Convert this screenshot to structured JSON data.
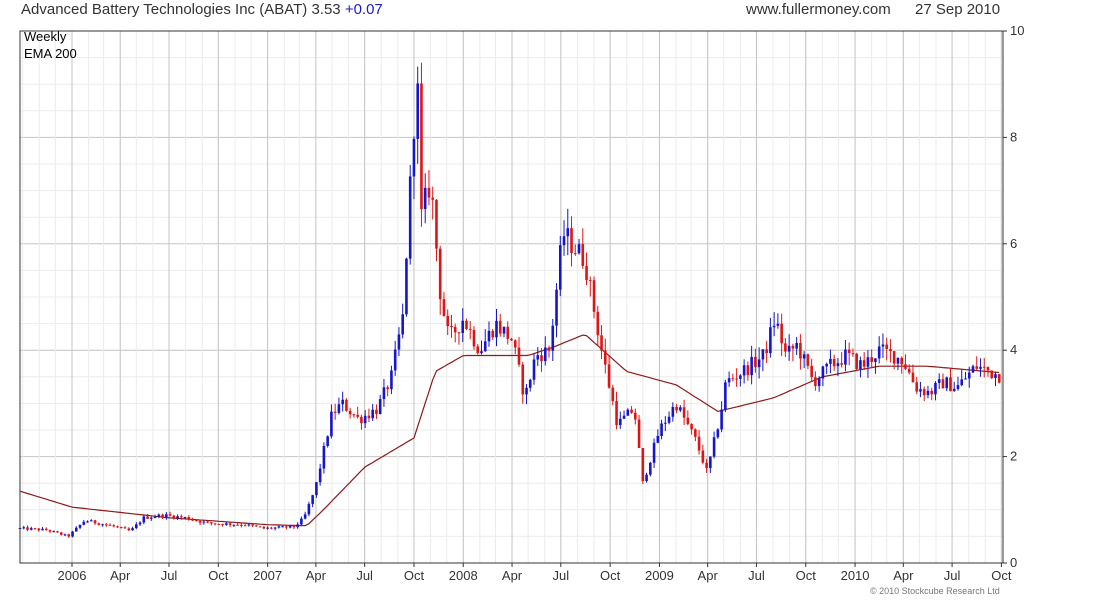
{
  "header": {
    "title": "Advanced Battery Technologies Inc (ABAT)",
    "price": "3.53",
    "change": "+0.07",
    "site": "www.fullermoney.com",
    "date": "27 Sep 2010"
  },
  "legend": {
    "weekly": "Weekly",
    "ema": "EMA 200"
  },
  "copyright": "© 2010 Stockcube Research Ltd",
  "colors": {
    "up": "#1515cc",
    "down": "#dd1515",
    "ema": "#8b1a1a",
    "grid": "#d9d9d9",
    "axis": "#333333"
  },
  "chart_data": {
    "type": "candlestick",
    "interval": "weekly",
    "y_axis": {
      "side": "right",
      "range": [
        0,
        10
      ],
      "ticks": [
        0,
        2,
        4,
        6,
        8,
        10
      ]
    },
    "x_axis": {
      "range": [
        "2005-09-26",
        "2010-10-04"
      ],
      "ticks": [
        {
          "date": "2006-01-01",
          "label": "2006"
        },
        {
          "date": "2006-04-01",
          "label": "Apr"
        },
        {
          "date": "2006-07-01",
          "label": "Jul"
        },
        {
          "date": "2006-10-01",
          "label": "Oct"
        },
        {
          "date": "2007-01-01",
          "label": "2007"
        },
        {
          "date": "2007-04-01",
          "label": "Apr"
        },
        {
          "date": "2007-07-01",
          "label": "Jul"
        },
        {
          "date": "2007-10-01",
          "label": "Oct"
        },
        {
          "date": "2008-01-01",
          "label": "2008"
        },
        {
          "date": "2008-04-01",
          "label": "Apr"
        },
        {
          "date": "2008-07-01",
          "label": "Jul"
        },
        {
          "date": "2008-10-01",
          "label": "Oct"
        },
        {
          "date": "2009-01-01",
          "label": "2009"
        },
        {
          "date": "2009-04-01",
          "label": "Apr"
        },
        {
          "date": "2009-07-01",
          "label": "Jul"
        },
        {
          "date": "2009-10-01",
          "label": "Oct"
        },
        {
          "date": "2010-01-01",
          "label": "2010"
        },
        {
          "date": "2010-04-01",
          "label": "Apr"
        },
        {
          "date": "2010-07-01",
          "label": "Jul"
        },
        {
          "date": "2010-10-01",
          "label": "Oct"
        }
      ]
    },
    "close_anchors": [
      [
        "2005-09-26",
        0.65
      ],
      [
        "2005-11-15",
        0.62
      ],
      [
        "2005-12-25",
        0.5
      ],
      [
        "2006-01-25",
        0.8
      ],
      [
        "2006-03-15",
        0.7
      ],
      [
        "2006-04-20",
        0.6
      ],
      [
        "2006-05-15",
        0.85
      ],
      [
        "2006-06-20",
        0.9
      ],
      [
        "2006-08-01",
        0.85
      ],
      [
        "2006-09-10",
        0.75
      ],
      [
        "2006-11-20",
        0.72
      ],
      [
        "2006-12-25",
        0.65
      ],
      [
        "2007-02-20",
        0.68
      ],
      [
        "2007-03-10",
        0.85
      ],
      [
        "2007-03-31",
        1.4
      ],
      [
        "2007-05-01",
        2.8
      ],
      [
        "2007-05-20",
        3.0
      ],
      [
        "2007-06-20",
        2.7
      ],
      [
        "2007-07-25",
        2.9
      ],
      [
        "2007-08-20",
        3.5
      ],
      [
        "2007-09-10",
        4.6
      ],
      [
        "2007-10-01",
        8.3
      ],
      [
        "2007-10-08",
        8.8
      ],
      [
        "2007-10-15",
        6.5
      ],
      [
        "2007-11-01",
        7.2
      ],
      [
        "2007-11-20",
        5.0
      ],
      [
        "2007-12-05",
        4.2
      ],
      [
        "2008-01-01",
        4.6
      ],
      [
        "2008-02-01",
        4.0
      ],
      [
        "2008-03-01",
        4.5
      ],
      [
        "2008-04-01",
        4.2
      ],
      [
        "2008-04-25",
        3.1
      ],
      [
        "2008-05-15",
        3.9
      ],
      [
        "2008-06-10",
        4.0
      ],
      [
        "2008-07-05",
        6.2
      ],
      [
        "2008-08-15",
        5.7
      ],
      [
        "2008-09-15",
        4.0
      ],
      [
        "2008-10-15",
        2.6
      ],
      [
        "2008-11-15",
        2.9
      ],
      [
        "2008-12-01",
        1.5
      ],
      [
        "2009-01-01",
        2.5
      ],
      [
        "2009-02-01",
        3.0
      ],
      [
        "2009-03-10",
        2.3
      ],
      [
        "2009-03-31",
        1.7
      ],
      [
        "2009-04-25",
        2.8
      ],
      [
        "2009-05-05",
        3.4
      ],
      [
        "2009-06-05",
        3.6
      ],
      [
        "2009-07-15",
        3.9
      ],
      [
        "2009-08-05",
        4.6
      ],
      [
        "2009-08-25",
        3.9
      ],
      [
        "2009-09-15",
        4.1
      ],
      [
        "2009-10-15",
        3.4
      ],
      [
        "2009-11-15",
        3.7
      ],
      [
        "2009-12-15",
        3.9
      ],
      [
        "2010-01-15",
        3.7
      ],
      [
        "2010-02-15",
        4.0
      ],
      [
        "2010-03-15",
        3.9
      ],
      [
        "2010-04-01",
        3.8
      ],
      [
        "2010-04-25",
        3.3
      ],
      [
        "2010-05-20",
        3.2
      ],
      [
        "2010-06-15",
        3.4
      ],
      [
        "2010-07-10",
        3.3
      ],
      [
        "2010-08-15",
        3.7
      ],
      [
        "2010-09-27",
        3.53
      ]
    ],
    "ema200_anchors": [
      [
        "2005-09-26",
        1.35
      ],
      [
        "2006-01-01",
        1.05
      ],
      [
        "2006-07-01",
        0.85
      ],
      [
        "2007-01-01",
        0.72
      ],
      [
        "2007-03-15",
        0.7
      ],
      [
        "2007-04-15",
        1.0
      ],
      [
        "2007-07-01",
        1.8
      ],
      [
        "2007-10-01",
        2.35
      ],
      [
        "2007-11-10",
        3.6
      ],
      [
        "2008-01-01",
        3.9
      ],
      [
        "2008-05-01",
        3.9
      ],
      [
        "2008-06-15",
        4.05
      ],
      [
        "2008-08-15",
        4.3
      ],
      [
        "2008-11-01",
        3.6
      ],
      [
        "2009-02-01",
        3.35
      ],
      [
        "2009-04-20",
        2.85
      ],
      [
        "2009-08-01",
        3.1
      ],
      [
        "2009-11-01",
        3.5
      ],
      [
        "2010-02-15",
        3.7
      ],
      [
        "2010-05-15",
        3.7
      ],
      [
        "2010-09-27",
        3.58
      ]
    ]
  }
}
